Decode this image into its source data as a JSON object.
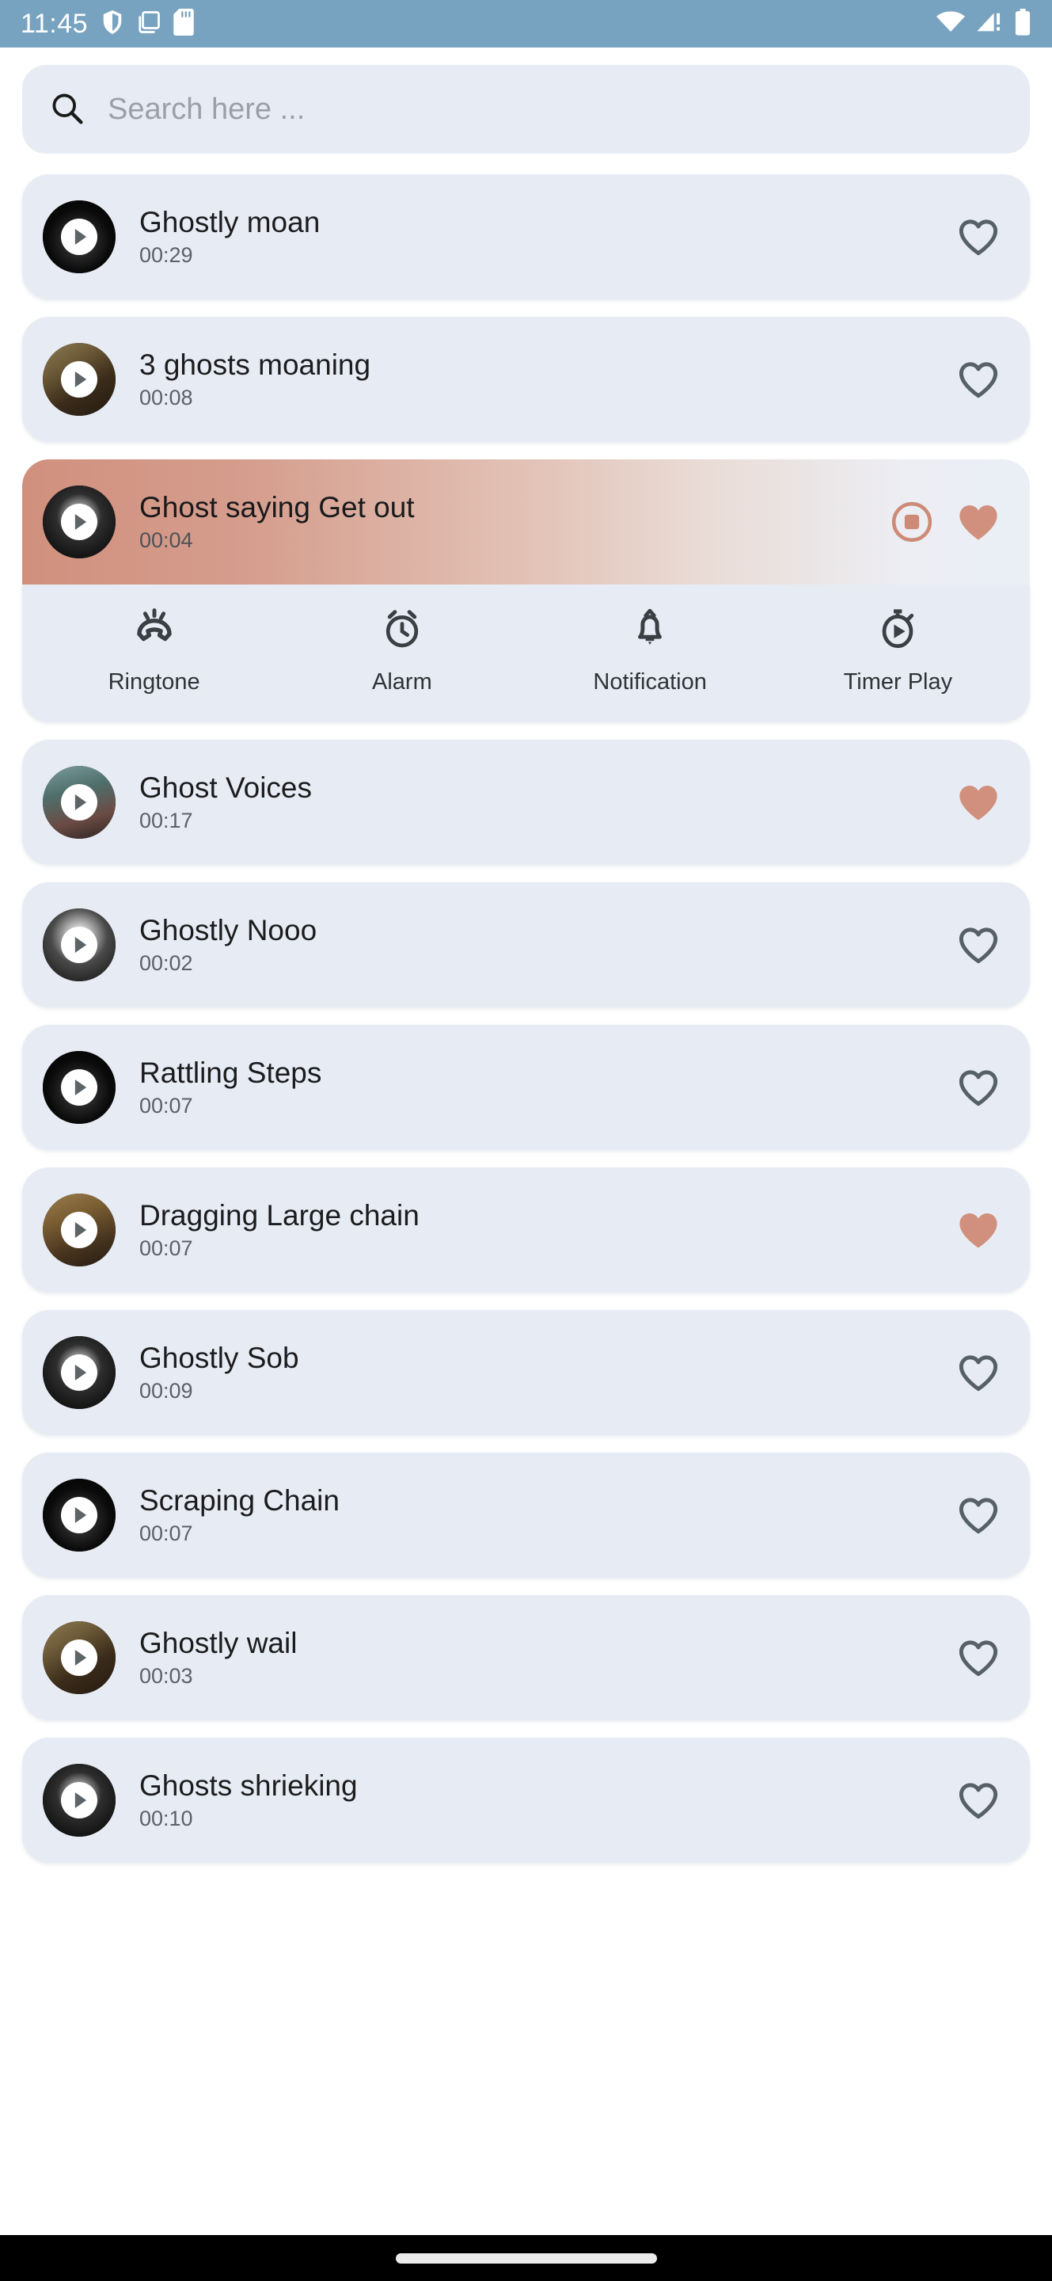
{
  "status_bar": {
    "time": "11:45",
    "left_icons": [
      "shield-icon",
      "screenshot-icon",
      "sd-card-icon"
    ],
    "right_icons": [
      "wifi-icon",
      "cellular-no-sim-icon",
      "battery-icon"
    ],
    "background_color": "#78a3c0"
  },
  "search": {
    "placeholder": "Search here ...",
    "value": "",
    "icon": "search-icon"
  },
  "theme": {
    "card_background": "#e7ecf4",
    "accent_salmon": "#d1907e",
    "heart_outline": "#566066",
    "page_background": "#ffffff",
    "nav_background": "#000000"
  },
  "expanded_actions": [
    {
      "label": "Ringtone",
      "icon": "ringtone-icon"
    },
    {
      "label": "Alarm",
      "icon": "alarm-clock-icon"
    },
    {
      "label": "Notification",
      "icon": "bell-icon"
    },
    {
      "label": "Timer Play",
      "icon": "timer-play-icon"
    }
  ],
  "sounds": [
    {
      "title": "Ghostly moan",
      "duration": "00:29",
      "favorite": false,
      "playing": false,
      "art": "art-vinyl"
    },
    {
      "title": "3 ghosts moaning",
      "duration": "00:08",
      "favorite": false,
      "playing": false,
      "art": "art-birds"
    },
    {
      "title": "Ghost saying Get out",
      "duration": "00:04",
      "favorite": true,
      "playing": true,
      "art": "art-nun"
    },
    {
      "title": "Ghost Voices",
      "duration": "00:17",
      "favorite": true,
      "playing": false,
      "art": "art-forest"
    },
    {
      "title": "Ghostly Nooo",
      "duration": "00:02",
      "favorite": false,
      "playing": false,
      "art": "art-face"
    },
    {
      "title": "Rattling Steps",
      "duration": "00:07",
      "favorite": false,
      "playing": false,
      "art": "art-vinyl"
    },
    {
      "title": "Dragging Large chain",
      "duration": "00:07",
      "favorite": true,
      "playing": false,
      "art": "art-cave"
    },
    {
      "title": "Ghostly Sob",
      "duration": "00:09",
      "favorite": false,
      "playing": false,
      "art": "art-nun"
    },
    {
      "title": "Scraping Chain",
      "duration": "00:07",
      "favorite": false,
      "playing": false,
      "art": "art-vinyl"
    },
    {
      "title": "Ghostly wail",
      "duration": "00:03",
      "favorite": false,
      "playing": false,
      "art": "art-birds"
    },
    {
      "title": "Ghosts shrieking",
      "duration": "00:10",
      "favorite": false,
      "playing": false,
      "art": "art-nun"
    }
  ],
  "navigation_bar": {
    "gesture_pill": "home-pill"
  }
}
